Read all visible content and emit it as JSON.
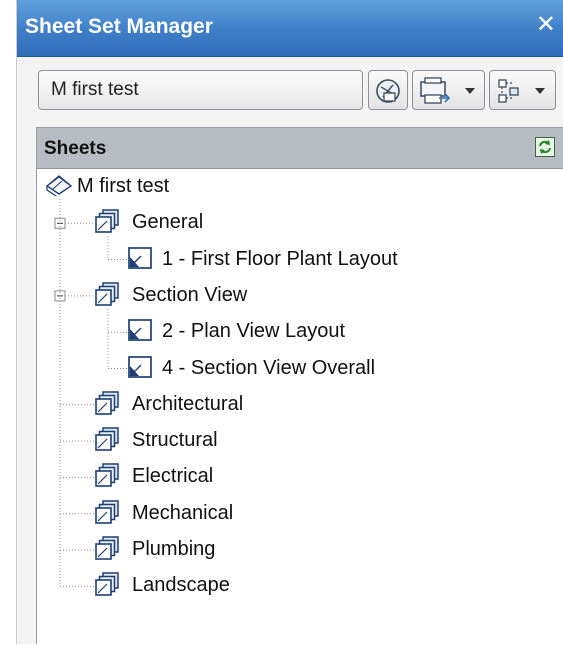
{
  "window": {
    "title": "Sheet Set Manager",
    "close_glyph": "✕"
  },
  "toolbar": {
    "sheet_set": "M first test"
  },
  "panel": {
    "heading": "Sheets"
  },
  "tree": {
    "root": "M first test",
    "groups": [
      {
        "label": "General",
        "sheets": [
          "1 - First Floor Plant Layout"
        ]
      },
      {
        "label": "Section View",
        "sheets": [
          "2 - Plan View Layout",
          "4 - Section View Overall"
        ]
      },
      {
        "label": "Architectural"
      },
      {
        "label": "Structural"
      },
      {
        "label": "Electrical"
      },
      {
        "label": "Mechanical"
      },
      {
        "label": "Plumbing"
      },
      {
        "label": "Landscape"
      }
    ]
  },
  "icons": {
    "close": "close-icon",
    "publish": "publish-icon",
    "plot": "plot-icon",
    "model_view": "model-view-icon",
    "refresh": "refresh-icon",
    "sheet_set": "sheet-set-icon",
    "subset": "subset-icon",
    "sheet": "sheet-icon"
  }
}
